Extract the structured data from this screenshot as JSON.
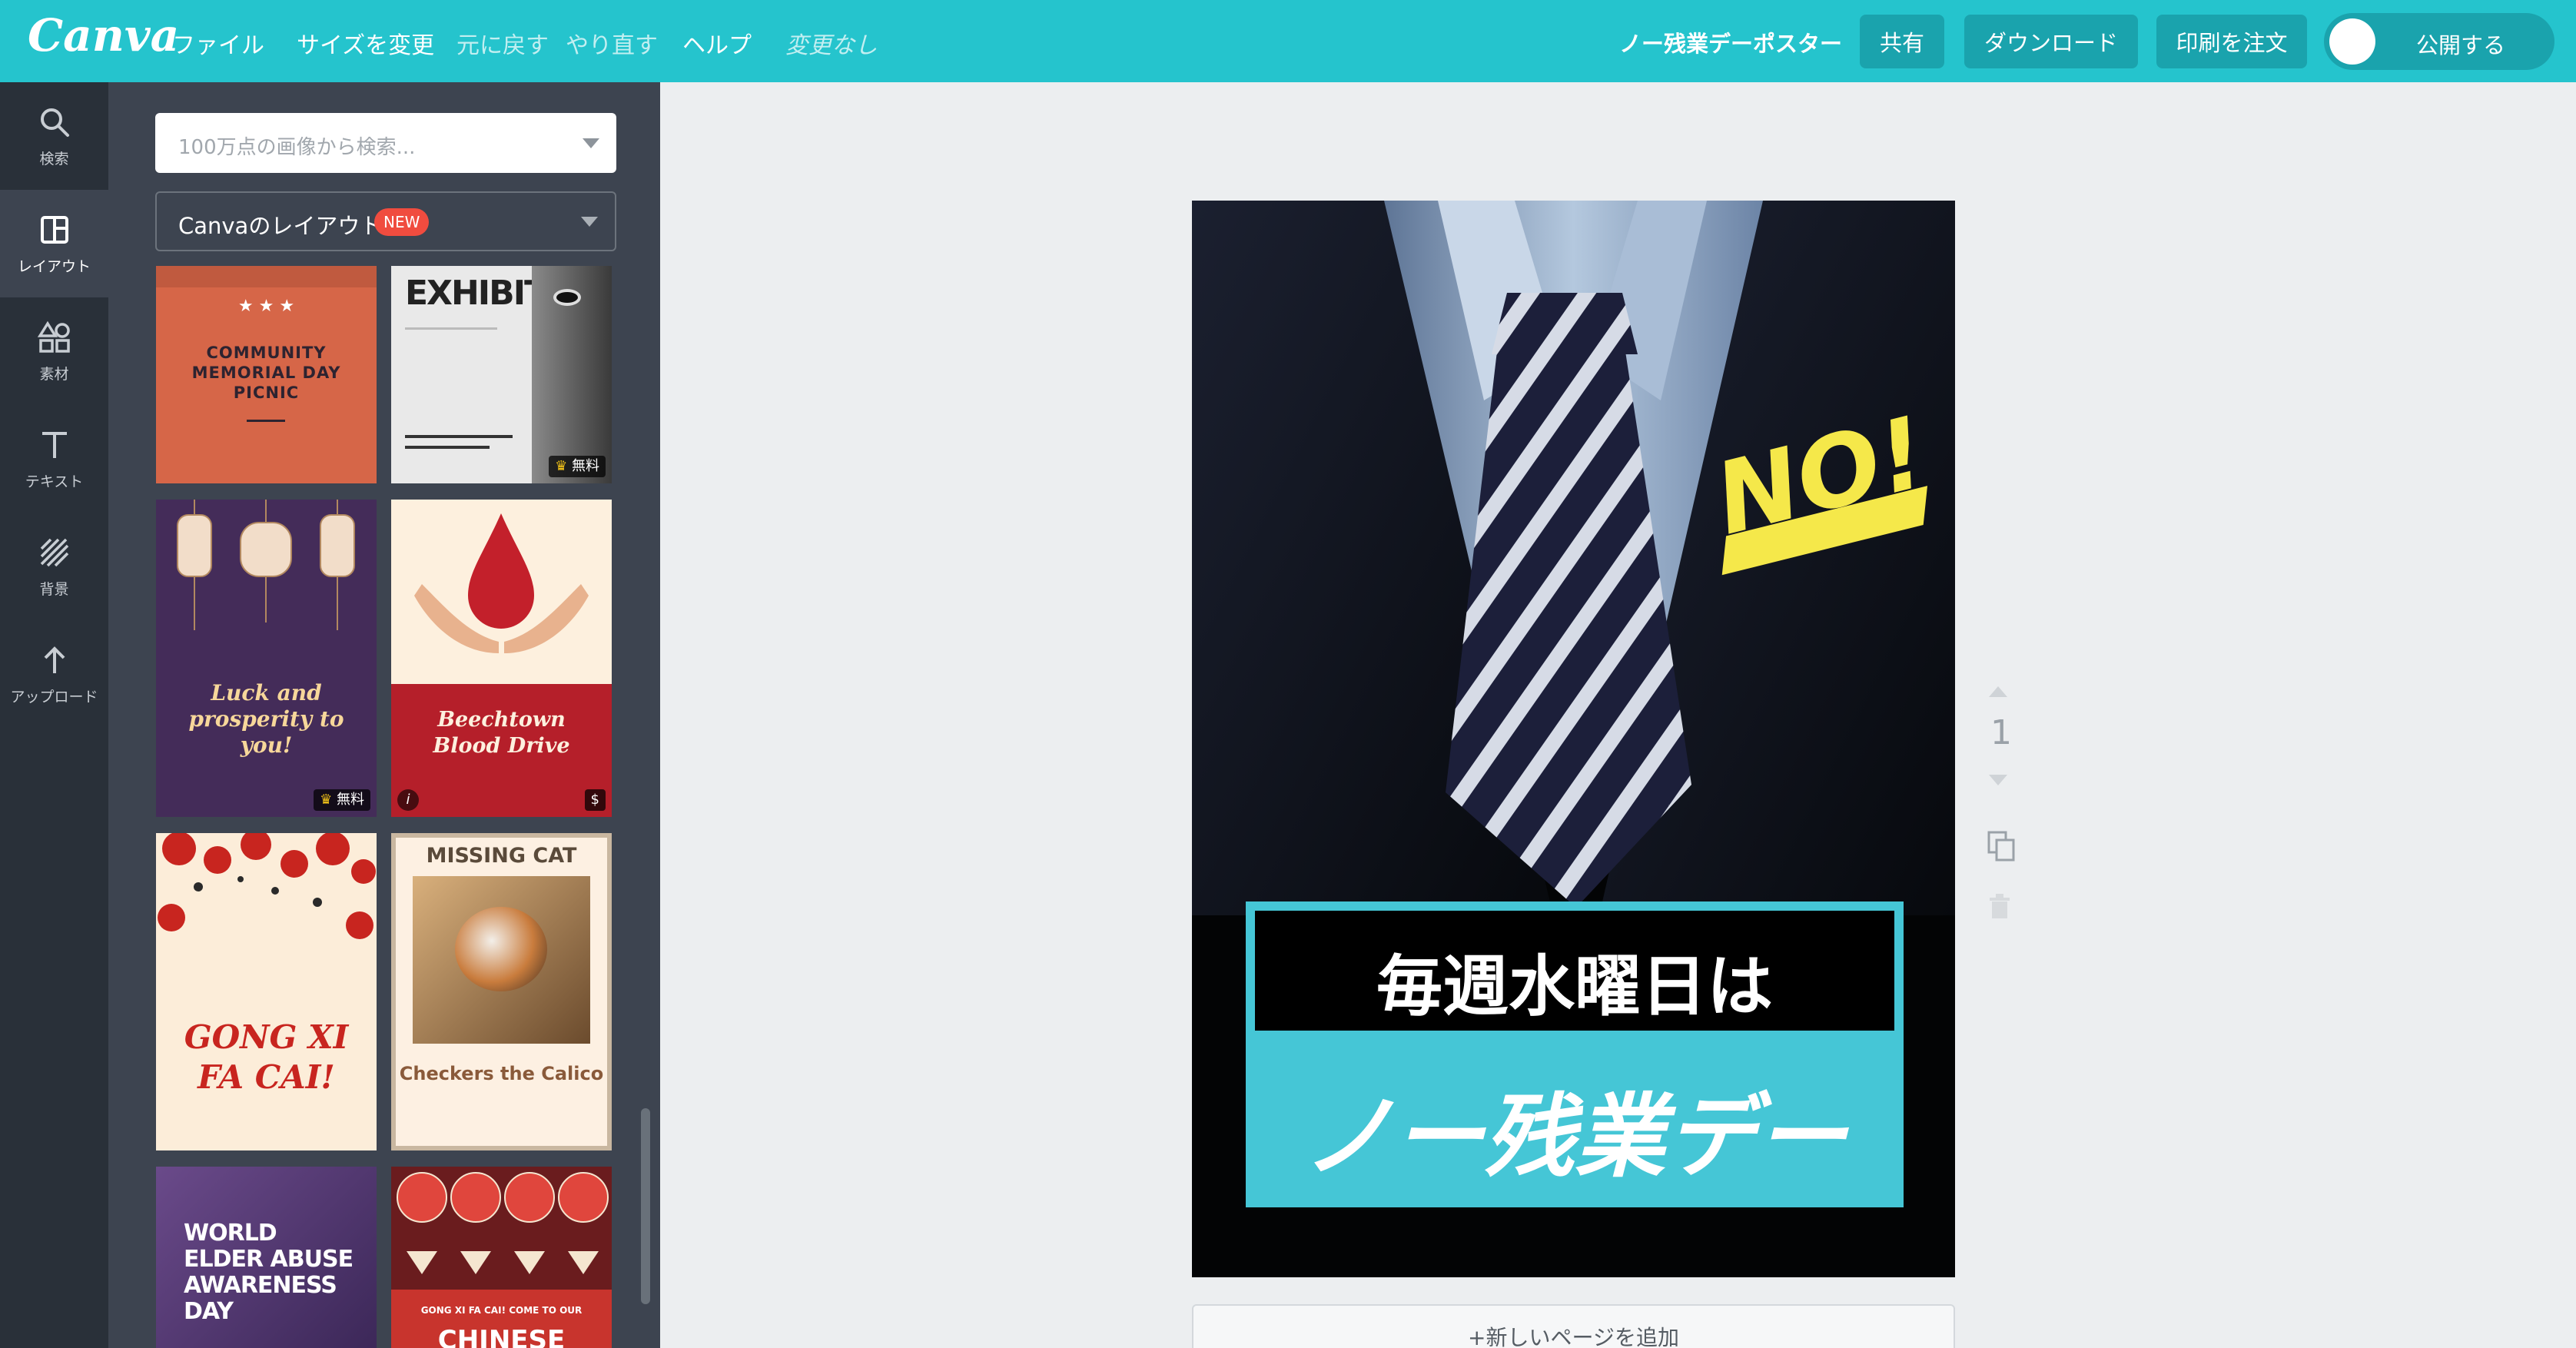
{
  "app": {
    "logo": "Canva"
  },
  "menu": {
    "file": "ファイル",
    "resize": "サイズを変更",
    "undo": "元に戻す",
    "redo": "やり直す",
    "help": "ヘルプ",
    "status": "変更なし"
  },
  "header": {
    "doc_title": "ノー残業デーポスター",
    "share": "共有",
    "download": "ダウンロード",
    "print": "印刷を注文",
    "publish": "公開する"
  },
  "rail": [
    {
      "label": "検索",
      "icon": "search-icon"
    },
    {
      "label": "レイアウト",
      "icon": "layout-icon",
      "active": true
    },
    {
      "label": "素材",
      "icon": "elements-icon"
    },
    {
      "label": "テキスト",
      "icon": "text-icon"
    },
    {
      "label": "背景",
      "icon": "background-icon"
    },
    {
      "label": "アップロード",
      "icon": "upload-icon"
    }
  ],
  "panel": {
    "search_placeholder": "100万点の画像から検索...",
    "layout_select": "Canvaのレイアウト",
    "new_badge": "NEW"
  },
  "templates": [
    {
      "title": "COMMUNITY MEMORIAL DAY PICNIC"
    },
    {
      "title": "EXHIBIT",
      "badge": "無料"
    },
    {
      "title": "Luck and prosperity to you!",
      "badge": "無料"
    },
    {
      "title": "Beechtown Blood Drive",
      "badge": "$"
    },
    {
      "title": "GONG XI FA CAI!"
    },
    {
      "title": "MISSING CAT",
      "subtitle": "Checkers the Calico"
    },
    {
      "title": "WORLD ELDER ABUSE AWARENESS DAY"
    },
    {
      "title": "GONG XI FA CAI! COME TO OUR",
      "title2": "CHINESE"
    }
  ],
  "poster": {
    "sticker": "NO!",
    "line1": "毎週水曜日は",
    "line2": "ノー残業デー"
  },
  "page": {
    "number": "1",
    "add_page": "+新しいページを追加"
  }
}
